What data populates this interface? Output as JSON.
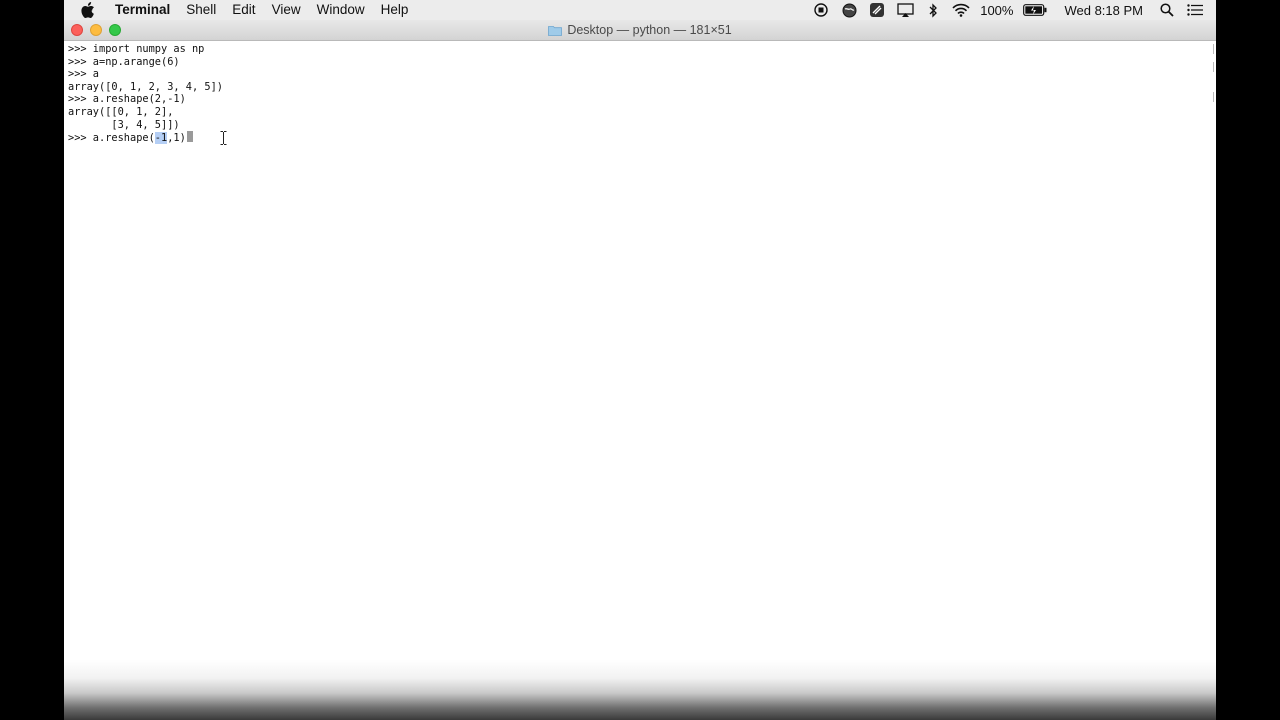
{
  "menubar": {
    "app_name": "Terminal",
    "menus": [
      "Shell",
      "Edit",
      "View",
      "Window",
      "Help"
    ],
    "battery": "100%",
    "clock": "Wed 8:18 PM",
    "status_icons": [
      "record-icon",
      "globe-icon",
      "tool-icon",
      "airplay-icon",
      "bluetooth-icon",
      "wifi-icon",
      "battery-icon",
      "search-icon",
      "list-icon"
    ]
  },
  "window": {
    "title": "Desktop — python — 181×51"
  },
  "terminal": {
    "lines": [
      ">>> import numpy as np",
      ">>> a=np.arange(6)",
      ">>> a",
      "array([0, 1, 2, 3, 4, 5])",
      ">>> a.reshape(2,-1)",
      "array([[0, 1, 2],",
      "       [3, 4, 5]])"
    ],
    "current_prompt": ">>> a.reshape(",
    "current_selected": "-1",
    "current_rest": ",1)"
  },
  "colors": {
    "close": "#fc605b",
    "minimize": "#fdbc40",
    "zoom": "#34c84a",
    "selection": "#b5cff5"
  }
}
